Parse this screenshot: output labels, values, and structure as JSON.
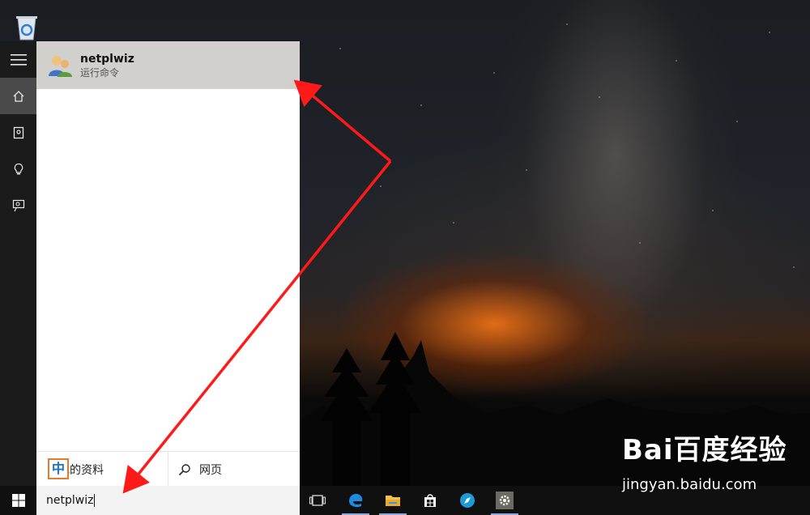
{
  "start_menu": {
    "rail": [
      {
        "name": "hamburger-icon"
      },
      {
        "name": "home-icon"
      },
      {
        "name": "notebook-icon"
      },
      {
        "name": "lightbulb-icon"
      },
      {
        "name": "feedback-icon"
      }
    ],
    "result": {
      "title": "netplwiz",
      "subtitle": "运行命令",
      "icon": "users-icon"
    },
    "filters": {
      "my_stuff_label": "我的资料",
      "web_label": "网页",
      "ime_label": "中"
    }
  },
  "taskbar": {
    "search_value": "netplwiz",
    "icons": [
      "task-view-icon",
      "edge-icon",
      "file-explorer-icon",
      "store-icon",
      "browser-icon",
      "settings-icon"
    ]
  },
  "watermark": {
    "logo": "Bai百度经验",
    "url": "jingyan.baidu.com"
  },
  "colors": {
    "annotation_arrow": "#ff1a1a",
    "result_highlight": "#d2d0cc",
    "taskbar": "#101010",
    "ime_border": "#e87a2a"
  }
}
